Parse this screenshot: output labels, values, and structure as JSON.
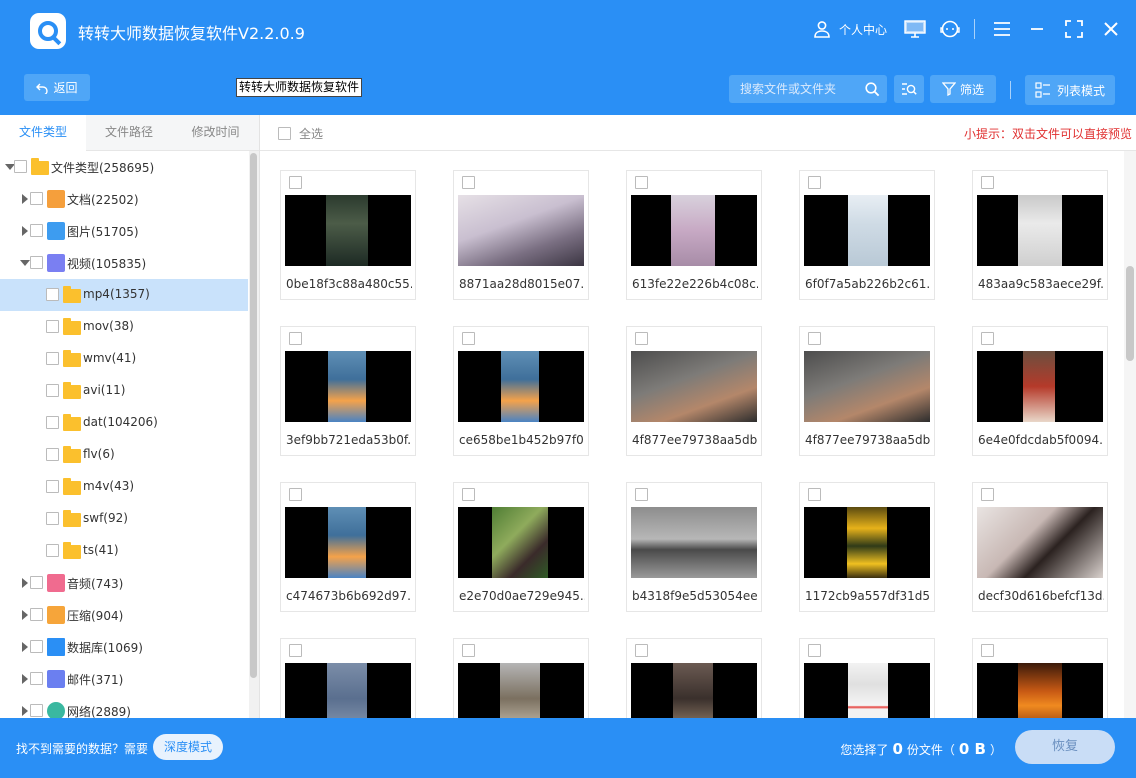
{
  "window": {
    "title": "转转大师数据恢复软件V2.2.0.9",
    "user_center": "个人中心",
    "icons": [
      "user-icon",
      "monitor-icon",
      "support-icon",
      "menu-icon",
      "minimize-icon",
      "maximize-icon",
      "close-icon"
    ]
  },
  "toolbar": {
    "back_label": "返回",
    "breadcrumb_tip": "转转大师数据恢复软件",
    "search_placeholder": "搜索文件或文件夹",
    "filter_label": "筛选",
    "view_mode_label": "列表模式"
  },
  "sidebar": {
    "tabs": [
      {
        "label": "文件类型",
        "active": true
      },
      {
        "label": "文件路径",
        "active": false
      },
      {
        "label": "修改时间",
        "active": false
      }
    ],
    "tree": [
      {
        "name": "文件类型",
        "count": "(258695)",
        "level": 0,
        "expand": "open",
        "icon": "folder"
      },
      {
        "name": "文档",
        "count": "(22502)",
        "level": 1,
        "expand": "closed",
        "icon": "doc"
      },
      {
        "name": "图片",
        "count": "(51705)",
        "level": 1,
        "expand": "closed",
        "icon": "image"
      },
      {
        "name": "视频",
        "count": "(105835)",
        "level": 1,
        "expand": "open",
        "icon": "video"
      },
      {
        "name": "mp4",
        "count": "(1357)",
        "level": 2,
        "expand": "none",
        "icon": "folder",
        "selected": true
      },
      {
        "name": "mov",
        "count": "(38)",
        "level": 2,
        "expand": "none",
        "icon": "folder"
      },
      {
        "name": "wmv",
        "count": "(41)",
        "level": 2,
        "expand": "none",
        "icon": "folder"
      },
      {
        "name": "avi",
        "count": "(11)",
        "level": 2,
        "expand": "none",
        "icon": "folder"
      },
      {
        "name": "dat",
        "count": "(104206)",
        "level": 2,
        "expand": "none",
        "icon": "folder"
      },
      {
        "name": "flv",
        "count": "(6)",
        "level": 2,
        "expand": "none",
        "icon": "folder"
      },
      {
        "name": "m4v",
        "count": "(43)",
        "level": 2,
        "expand": "none",
        "icon": "folder"
      },
      {
        "name": "swf",
        "count": "(92)",
        "level": 2,
        "expand": "none",
        "icon": "folder"
      },
      {
        "name": "ts",
        "count": "(41)",
        "level": 2,
        "expand": "none",
        "icon": "folder"
      },
      {
        "name": "音频",
        "count": "(743)",
        "level": 1,
        "expand": "closed",
        "icon": "audio"
      },
      {
        "name": "压缩",
        "count": "(904)",
        "level": 1,
        "expand": "closed",
        "icon": "zip"
      },
      {
        "name": "数据库",
        "count": "(1069)",
        "level": 1,
        "expand": "closed",
        "icon": "database"
      },
      {
        "name": "邮件",
        "count": "(371)",
        "level": 1,
        "expand": "closed",
        "icon": "mail"
      },
      {
        "name": "网络",
        "count": "(2889)",
        "level": 1,
        "expand": "closed",
        "icon": "network"
      }
    ]
  },
  "content": {
    "select_all_label": "全选",
    "hint": "小提示：双击文件可以直接预览",
    "files": [
      {
        "name": "0be18f3c88a480c55...",
        "shot": "dark-phone"
      },
      {
        "name": "8871aa28d8015e07...",
        "shot": "laptop"
      },
      {
        "name": "613fe22e226b4c08c...",
        "shot": "pink-phone"
      },
      {
        "name": "6f0f7a5ab226b2c61...",
        "shot": "chat"
      },
      {
        "name": "483aa9c583aece29f...",
        "shot": "white-phone"
      },
      {
        "name": "3ef9bb721eda53b0f...",
        "shot": "homescreen"
      },
      {
        "name": "ce658be1b452b97f0...",
        "shot": "homescreen"
      },
      {
        "name": "4f877ee79738aa5db...",
        "shot": "car-seat"
      },
      {
        "name": "4f877ee79738aa5db...",
        "shot": "car-seat"
      },
      {
        "name": "6e4e0fdcdab5f0094...",
        "shot": "red-hall"
      },
      {
        "name": "c474673b6b692d97...",
        "shot": "homescreen"
      },
      {
        "name": "e2e70d0ae729e945...",
        "shot": "garden"
      },
      {
        "name": "b4318f9e5d53054ee...",
        "shot": "car-road"
      },
      {
        "name": "1172cb9a557df31d5...",
        "shot": "flowers"
      },
      {
        "name": "decf30d616befcf13d...",
        "shot": "hair"
      },
      {
        "name": "",
        "shot": "jeans"
      },
      {
        "name": "",
        "shot": "street"
      },
      {
        "name": "",
        "shot": "car-interior"
      },
      {
        "name": "",
        "shot": "list-ui"
      },
      {
        "name": "",
        "shot": "orange-poster"
      }
    ]
  },
  "footer": {
    "missing_text": "找不到需要的数据？需要",
    "deep_mode_label": "深度模式",
    "selected_prefix": "您选择了",
    "selected_count": "0",
    "selected_unit": "份文件（",
    "selected_size": "0 B",
    "selected_suffix": "）",
    "recover_label": "恢复"
  },
  "colors": {
    "brand": "#2a8ff5",
    "hint": "#e03131",
    "selected_row": "#c9e2fb"
  }
}
